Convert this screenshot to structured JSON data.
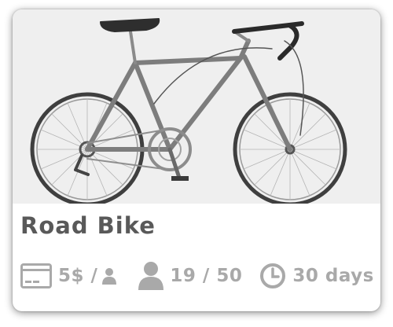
{
  "card": {
    "title": "Road Bike",
    "image_alt": "road-bike-photo",
    "stats": {
      "price": "5$ /",
      "participants": "19 / 50",
      "duration": "30 days"
    },
    "icons": {
      "price": "credit-card-icon",
      "per_person": "person-icon",
      "participants": "person-icon",
      "duration": "clock-icon"
    }
  },
  "colors": {
    "title": "#595959",
    "stats": "#a9a9a9",
    "image_background": "#efefef"
  }
}
